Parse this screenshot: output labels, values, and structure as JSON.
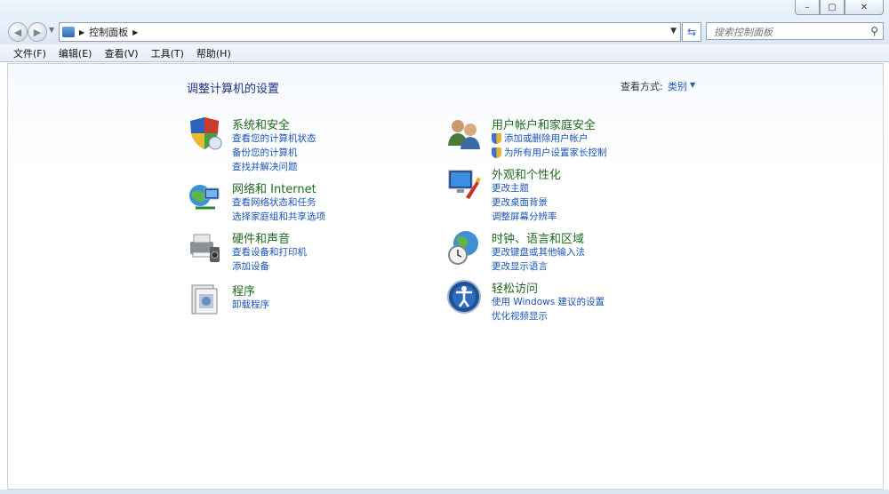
{
  "window": {
    "controls": {
      "minimize": "–",
      "maximize": "▢",
      "close": "✕"
    }
  },
  "nav": {
    "back": "◀",
    "forward": "▶",
    "address": {
      "path": [
        "控制面板"
      ]
    },
    "search": {
      "placeholder": "搜索控制面板"
    }
  },
  "menubar": [
    {
      "label": "文件(F)"
    },
    {
      "label": "编辑(E)"
    },
    {
      "label": "查看(V)"
    },
    {
      "label": "工具(T)"
    },
    {
      "label": "帮助(H)"
    }
  ],
  "main": {
    "title": "调整计算机的设置",
    "view_by_label": "查看方式:",
    "view_by_value": "类别"
  },
  "categories": [
    {
      "icon": "system-security-icon",
      "title": "系统和安全",
      "links": [
        "查看您的计算机状态",
        "备份您的计算机",
        "查找并解决问题"
      ]
    },
    {
      "icon": "network-internet-icon",
      "title": "网络和 Internet",
      "links": [
        "查看网络状态和任务",
        "选择家庭组和共享选项"
      ]
    },
    {
      "icon": "hardware-sound-icon",
      "title": "硬件和声音",
      "links": [
        "查看设备和打印机",
        "添加设备"
      ]
    },
    {
      "icon": "programs-icon",
      "title": "程序",
      "links": [
        "卸载程序"
      ]
    },
    {
      "icon": "user-accounts-icon",
      "title": "用户帐户和家庭安全",
      "links": [
        "添加或删除用户帐户",
        "为所有用户设置家长控制"
      ]
    },
    {
      "icon": "appearance-icon",
      "title": "外观和个性化",
      "links": [
        "更改主题",
        "更改桌面背景",
        "调整屏幕分辨率"
      ]
    },
    {
      "icon": "clock-region-icon",
      "title": "时钟、语言和区域",
      "links": [
        "更改键盘或其他输入法",
        "更改显示语言"
      ]
    },
    {
      "icon": "ease-of-access-icon",
      "title": "轻松访问",
      "links": [
        "使用 Windows 建议的设置",
        "优化视频显示"
      ]
    }
  ],
  "colors": {
    "title_blue": "#1e3287",
    "category_green": "#1e6a1e",
    "link_blue": "#1a54b5"
  }
}
